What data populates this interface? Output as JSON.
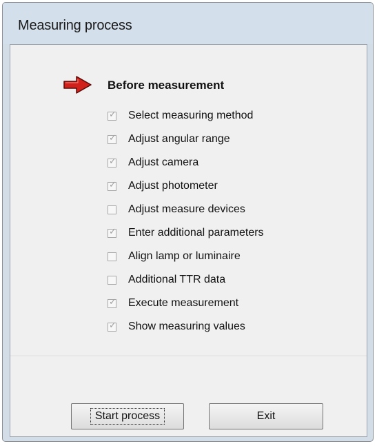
{
  "window": {
    "title": "Measuring process"
  },
  "stage": {
    "heading": "Before measurement",
    "indicator_icon": "red-arrow-right-icon",
    "indicator_color": "#d0211b"
  },
  "steps": [
    {
      "label": "Select measuring method",
      "checked": true
    },
    {
      "label": "Adjust angular range",
      "checked": true
    },
    {
      "label": "Adjust camera",
      "checked": true
    },
    {
      "label": "Adjust photometer",
      "checked": true
    },
    {
      "label": "Adjust measure devices",
      "checked": false
    },
    {
      "label": "Enter additional parameters",
      "checked": true
    },
    {
      "label": "Align lamp or luminaire",
      "checked": false
    },
    {
      "label": "Additional TTR data",
      "checked": false
    },
    {
      "label": "Execute measurement",
      "checked": true
    },
    {
      "label": "Show measuring values",
      "checked": true
    }
  ],
  "buttons": {
    "start_label": "Start process",
    "exit_label": "Exit"
  }
}
